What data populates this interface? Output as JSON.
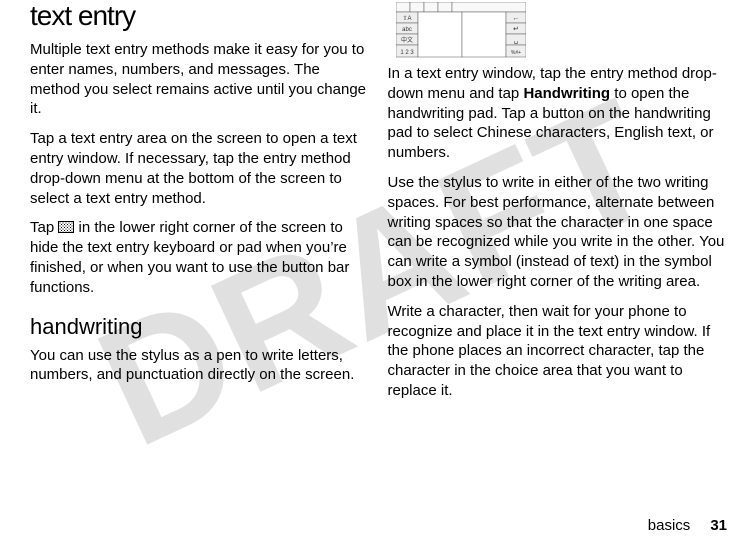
{
  "watermark": "DRAFT",
  "left": {
    "heading": "text entry",
    "p1": "Multiple text entry methods make it easy for you to enter names, numbers, and messages. The method you select remains active until you change it.",
    "p2": "Tap a text entry area on the screen to open a text entry window. If necessary, tap the entry method drop-down menu at the bottom of the screen to select a text entry method.",
    "p3a": "Tap ",
    "p3b": " in the lower right corner of the screen to hide the text entry keyboard or pad when you’re finished, or when you want to use the button bar functions.",
    "subheading": "handwriting",
    "p4": "You can use the stylus as a pen to write letters, numbers, and punctuation directly on the screen."
  },
  "right": {
    "p1a": "In a text entry window, tap the entry method drop-down menu and tap ",
    "p1bold": "Handwriting",
    "p1b": " to open the handwriting pad. Tap a button on the handwriting pad to select Chinese characters, English text, or numbers.",
    "p2": "Use the stylus to write in either of the two writing spaces. For best performance, alternate between writing spaces so that the character in one space can be recognized while you write in the other. You can write a symbol (instead of text) in the symbol box in the lower right corner of the writing area.",
    "p3": "Write a character, then wait for your phone to recognize and place it in the text entry window. If the phone places an incorrect character, tap the character in the choice area that you want to replace it."
  },
  "pad": {
    "row1_label": "⇧A",
    "row2_label": "abc",
    "row3_label": "中文",
    "row4_label": "1 2 3",
    "right_top": "←",
    "right_mid": "↵",
    "right_bot1": "␣",
    "right_bot2": "%#+"
  },
  "footer": {
    "section": "basics",
    "page": "31"
  }
}
